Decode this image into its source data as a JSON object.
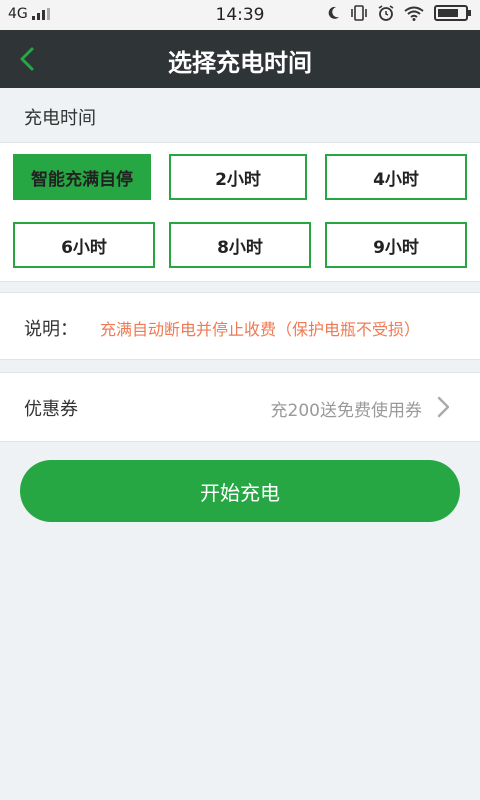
{
  "status_bar": {
    "network": "4G",
    "time": "14:39"
  },
  "header": {
    "title": "选择充电时间"
  },
  "charge_time": {
    "label": "充电时间",
    "options": [
      "智能充满自停",
      "2小时",
      "4小时",
      "6小时",
      "8小时",
      "9小时"
    ],
    "selected_index": 0
  },
  "note": {
    "label": "说明：",
    "text": "充满自动断电并停止收费（保护电瓶不受损）"
  },
  "coupon": {
    "label": "优惠券",
    "value": "充200送免费使用券"
  },
  "start_button": {
    "label": "开始充电"
  },
  "colors": {
    "accent": "#27a744",
    "header_bg": "#2f3436",
    "note_text": "#ef7a54"
  }
}
